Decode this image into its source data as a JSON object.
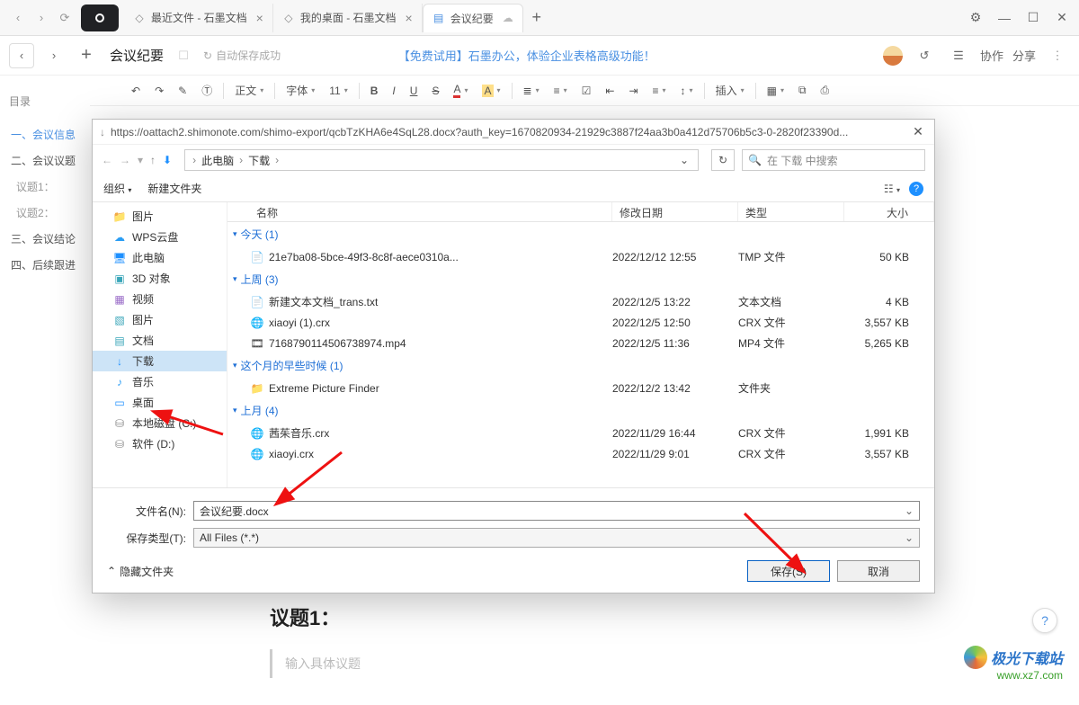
{
  "browser": {
    "tabs": [
      {
        "title": "最近文件 - 石墨文档"
      },
      {
        "title": "我的桌面 - 石墨文档"
      },
      {
        "title": "会议纪要",
        "active": true
      }
    ]
  },
  "app": {
    "doc_title": "会议纪要",
    "autosave": "自动保存成功",
    "trial": "【免费试用】石墨办公，体验企业表格高级功能！",
    "collab": "协作",
    "share": "分享"
  },
  "fmt": {
    "style": "正文",
    "font": "字体",
    "size": "11",
    "insert": "插入"
  },
  "outline": {
    "title": "目录",
    "items": [
      {
        "label": "一、会议信息",
        "cls": "lvl1"
      },
      {
        "label": "二、会议议题"
      },
      {
        "label": "议题1：",
        "sub": true
      },
      {
        "label": "议题2：",
        "sub": true
      },
      {
        "label": "三、会议结论"
      },
      {
        "label": "四、后续跟进"
      }
    ]
  },
  "doc": {
    "heading": "议题1：",
    "placeholder": "输入具体议题"
  },
  "dialog": {
    "url": "https://oattach2.shimonote.com/shimo-export/qcbTzKHA6e4SqL28.docx?auth_key=1670820934-21929c3887f24aa3b0a412d75706b5c3-0-2820f23390d...",
    "crumbs": [
      "此电脑",
      "下载"
    ],
    "search_ph": "在 下载 中搜索",
    "organize": "组织",
    "new_folder": "新建文件夹",
    "cols": {
      "name": "名称",
      "date": "修改日期",
      "type": "类型",
      "size": "大小"
    },
    "tree": [
      {
        "label": "图片",
        "ico": "📁",
        "color": "#f3c14a"
      },
      {
        "label": "WPS云盘",
        "ico": "☁",
        "color": "#2a9df4"
      },
      {
        "label": "此电脑",
        "ico": "🖥",
        "color": "#1e90ff"
      },
      {
        "label": "3D 对象",
        "ico": "▣",
        "color": "#3aa6b9"
      },
      {
        "label": "视频",
        "ico": "▦",
        "color": "#9a6cc8"
      },
      {
        "label": "图片",
        "ico": "▧",
        "color": "#3aa6b9"
      },
      {
        "label": "文档",
        "ico": "▤",
        "color": "#3aa6b9"
      },
      {
        "label": "下载",
        "ico": "↓",
        "sel": true,
        "color": "#1e90ff"
      },
      {
        "label": "音乐",
        "ico": "♪",
        "color": "#2a9df4"
      },
      {
        "label": "桌面",
        "ico": "▭",
        "color": "#1e90ff"
      },
      {
        "label": "本地磁盘 (C:)",
        "ico": "⛁",
        "color": "#888"
      },
      {
        "label": "软件 (D:)",
        "ico": "⛁",
        "color": "#888"
      }
    ],
    "groups": [
      {
        "title": "今天 (1)",
        "rows": [
          {
            "ico": "📄",
            "name": "21e7ba08-5bce-49f3-8c8f-aece0310a...",
            "date": "2022/12/12 12:55",
            "type": "TMP 文件",
            "size": "50 KB"
          }
        ]
      },
      {
        "title": "上周 (3)",
        "rows": [
          {
            "ico": "📄",
            "name": "新建文本文档_trans.txt",
            "date": "2022/12/5 13:22",
            "type": "文本文档",
            "size": "4 KB"
          },
          {
            "ico": "🌐",
            "name": "xiaoyi (1).crx",
            "date": "2022/12/5 12:50",
            "type": "CRX 文件",
            "size": "3,557 KB"
          },
          {
            "ico": "🎞",
            "name": "7168790114506738974.mp4",
            "date": "2022/12/5 11:36",
            "type": "MP4 文件",
            "size": "5,265 KB"
          }
        ]
      },
      {
        "title": "这个月的早些时候 (1)",
        "rows": [
          {
            "ico": "📁",
            "name": "Extreme Picture Finder",
            "date": "2022/12/2 13:42",
            "type": "文件夹",
            "size": ""
          }
        ]
      },
      {
        "title": "上月 (4)",
        "rows": [
          {
            "ico": "🌐",
            "name": "茜茱音乐.crx",
            "date": "2022/11/29 16:44",
            "type": "CRX 文件",
            "size": "1,991 KB"
          },
          {
            "ico": "🌐",
            "name": "xiaoyi.crx",
            "date": "2022/11/29 9:01",
            "type": "CRX 文件",
            "size": "3,557 KB"
          }
        ]
      }
    ],
    "filename_label": "文件名(N):",
    "filename_value": "会议纪要.docx",
    "savetype_label": "保存类型(T):",
    "savetype_value": "All Files (*.*)",
    "hide_folders": "隐藏文件夹",
    "save_btn": "保存(S)",
    "cancel_btn": "取消"
  },
  "watermark": {
    "brand": "极光下载站",
    "site": "www.xz7.com"
  }
}
